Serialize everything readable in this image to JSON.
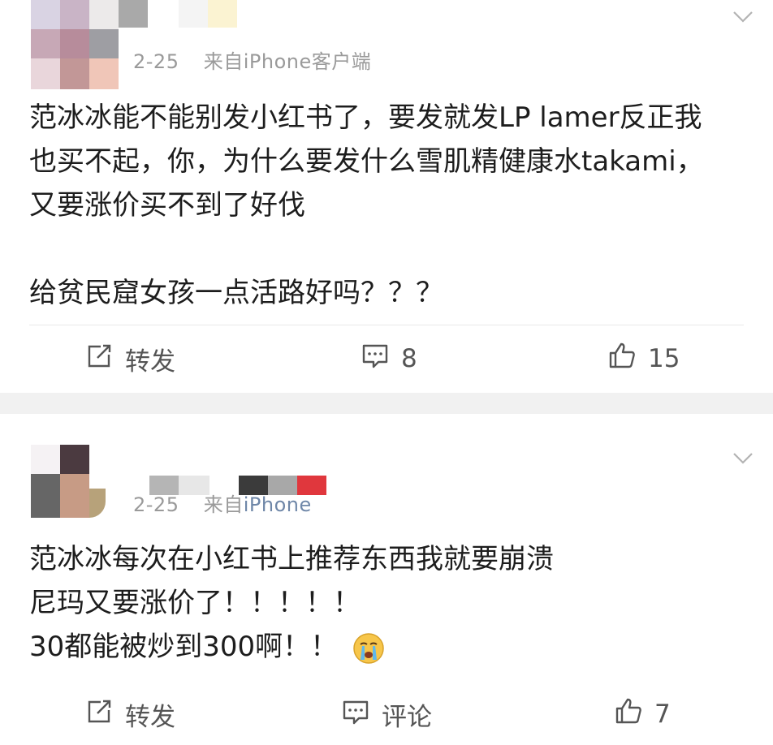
{
  "post1": {
    "meta_date": "2-25",
    "meta_source": "来自iPhone客户端",
    "text_lines": [
      "范冰冰能不能别发小红书了，要发就发LP lamer反正我",
      "也买不起，你，为什么要发什么雪肌精健康水takami，",
      "又要涨价买不到了好伐",
      "",
      "给贫民窟女孩一点活路好吗？？？"
    ],
    "actions": {
      "repost_label": "转发",
      "comment_count": "8",
      "like_count": "15"
    }
  },
  "post2": {
    "meta_date": "2-25",
    "meta_source_prefix": "来自",
    "meta_source_link": "iPhone",
    "text_lines": [
      "范冰冰每次在小红书上推荐东西我就要崩溃",
      "尼玛又要涨价了！！！！！",
      "30都能被炒到300啊！！"
    ],
    "actions": {
      "repost_label": "转发",
      "comment_label": "评论",
      "like_count": "7"
    }
  },
  "icons": {
    "repost": "repost-icon",
    "comment": "comment-icon",
    "like": "like-icon",
    "menu": "chevron-down-icon",
    "emoji": "crying-face-emoji"
  },
  "colors": {
    "text": "#1d1d1d",
    "meta": "#9a9a9a",
    "link": "#6f87a8",
    "separator": "#f1f1f1"
  }
}
